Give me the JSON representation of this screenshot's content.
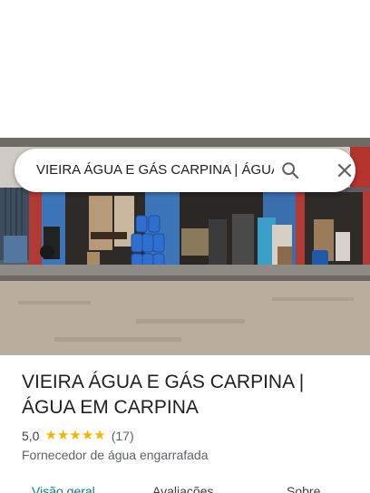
{
  "search": {
    "query": "VIEIRA ÁGUA E GÁS CARPINA | ÁGUA EM CARPINA",
    "search_icon": "search-icon",
    "close_icon": "close-icon"
  },
  "place": {
    "title": "VIEIRA ÁGUA E GÁS CARPINA | ÁGUA EM CARPINA",
    "rating": "5,0",
    "stars": 5,
    "reviews": "(17)",
    "category": "Fornecedor de água engarrafada"
  },
  "tabs": [
    {
      "label": "Visão geral",
      "active": true
    },
    {
      "label": "Avaliações",
      "active": false
    },
    {
      "label": "Sobre",
      "active": false
    }
  ],
  "colors": {
    "star": "#f4b400",
    "active_tab": "#0b7e83",
    "text": "#202124",
    "secondary_text": "#5f6368"
  }
}
